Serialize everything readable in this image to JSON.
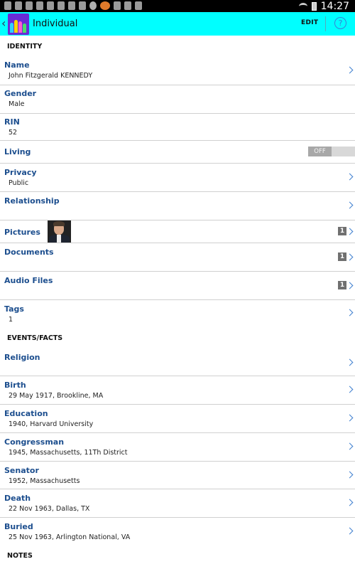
{
  "status_bar": {
    "time": "14:27",
    "icons": [
      "signal-icon",
      "lock-icon",
      "shield-icon",
      "image-icon",
      "usb-icon",
      "image-icon",
      "shield-icon",
      "ninja-icon",
      "face-icon",
      "feed-icon",
      "f-icon",
      "o-icon",
      "v-icon",
      "wifi-icon",
      "battery-icon"
    ]
  },
  "action_bar": {
    "title": "Individual",
    "edit_label": "EDIT",
    "help_label": "?"
  },
  "identity": {
    "header": "IDENTITY",
    "name": {
      "label": "Name",
      "value": "John Fitzgerald KENNEDY"
    },
    "gender": {
      "label": "Gender",
      "value": "Male"
    },
    "rin": {
      "label": "RIN",
      "value": "52"
    },
    "living": {
      "label": "Living",
      "toggle": "OFF"
    },
    "privacy": {
      "label": "Privacy",
      "value": "Public"
    },
    "relationship": {
      "label": "Relationship"
    },
    "pictures": {
      "label": "Pictures",
      "count": "1"
    },
    "documents": {
      "label": "Documents",
      "count": "1"
    },
    "audio_files": {
      "label": "Audio Files",
      "count": "1"
    },
    "tags": {
      "label": "Tags",
      "value": "1"
    }
  },
  "events": {
    "header": "EVENTS/FACTS",
    "religion": {
      "label": "Religion"
    },
    "birth": {
      "label": "Birth",
      "value": "29 May 1917, Brookline, MA"
    },
    "education": {
      "label": "Education",
      "value": "1940, Harvard University"
    },
    "congressman": {
      "label": "Congressman",
      "value": "1945, Massachusetts, 11Th District"
    },
    "senator": {
      "label": "Senator",
      "value": "1952, Massachusetts"
    },
    "death": {
      "label": "Death",
      "value": "22 Nov 1963, Dallas, TX"
    },
    "buried": {
      "label": "Buried",
      "value": "25 Nov 1963, Arlington National, VA"
    }
  },
  "notes": {
    "header": "NOTES"
  },
  "colors": {
    "action_bar": "#00ffff",
    "label": "#1c4e8e",
    "chevron": "#3f7fcf",
    "divider": "#d0d0d0"
  }
}
